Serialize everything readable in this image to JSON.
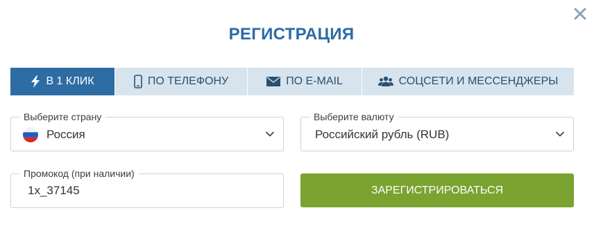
{
  "modal": {
    "title": "РЕГИСТРАЦИЯ"
  },
  "tabs": [
    {
      "label": "В 1 КЛИК",
      "icon": "lightning-icon",
      "active": true
    },
    {
      "label": "ПО ТЕЛЕФОНУ",
      "icon": "phone-icon",
      "active": false
    },
    {
      "label": "ПО E-MAIL",
      "icon": "envelope-icon",
      "active": false
    },
    {
      "label": "СОЦСЕТИ И МЕССЕНДЖЕРЫ",
      "icon": "people-icon",
      "active": false
    }
  ],
  "country": {
    "label": "Выберите страну",
    "value": "Россия",
    "icon": "russia-flag-icon"
  },
  "currency": {
    "label": "Выберите валюту",
    "value": "Российский рубль (RUB)"
  },
  "promo": {
    "label": "Промокод (при наличии)",
    "value": "1x_37145"
  },
  "register": {
    "label": "ЗАРЕГИСТРИРОВАТЬСЯ"
  },
  "colors": {
    "title": "#2d6aa6",
    "tab_active_bg": "#2e6ca4",
    "tab_bg": "#d7e4ee",
    "register_bg": "#7aa330"
  }
}
